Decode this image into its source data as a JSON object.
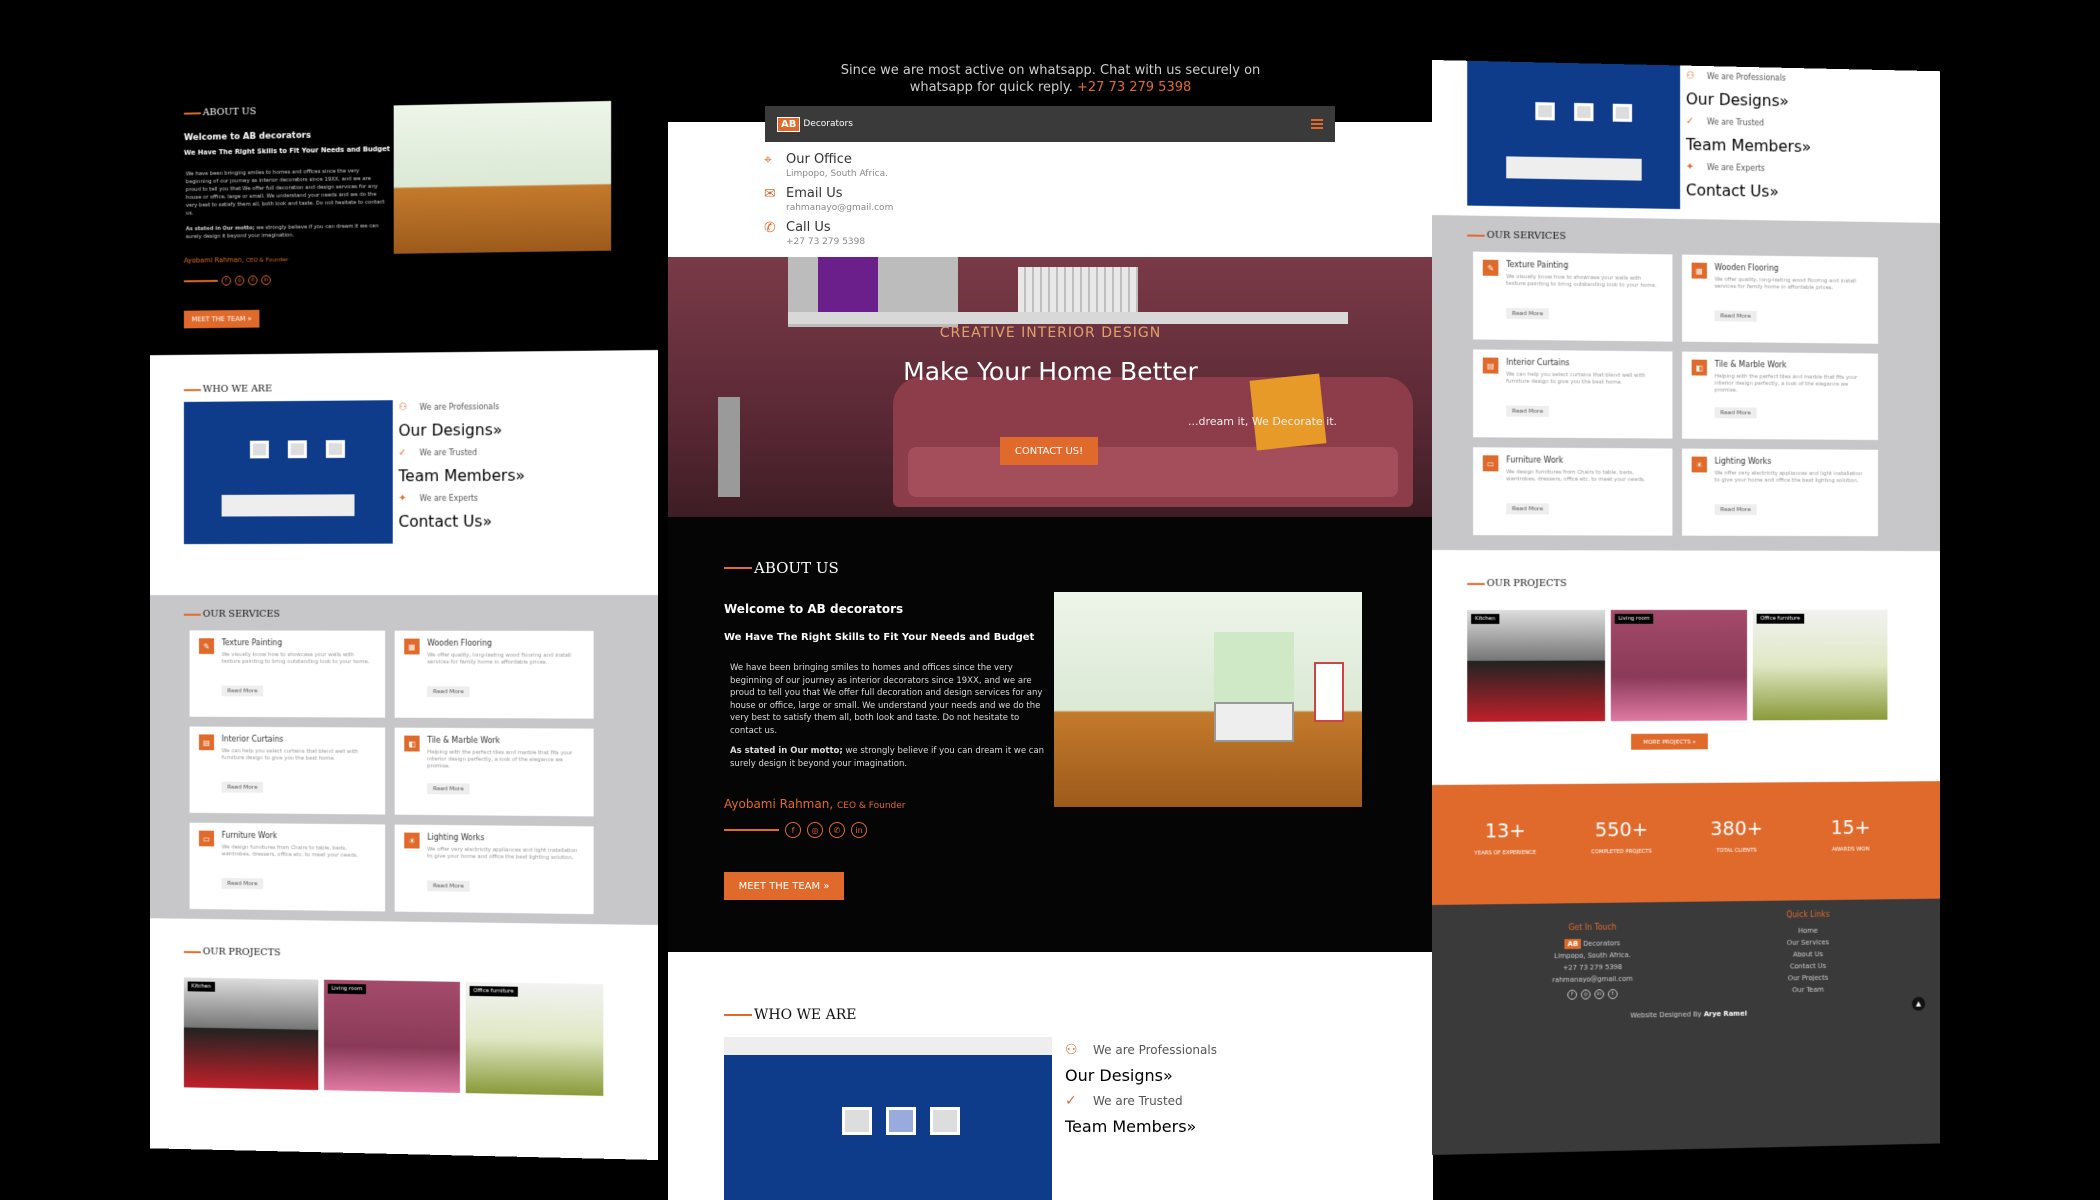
{
  "whatsapp_note": {
    "line1": "Since we are most active on whatsapp. Chat with us securely on",
    "line2": "whatsapp for quick reply.",
    "phone": "+27 73 279 5398"
  },
  "nav": {
    "logo_mark": "AB",
    "logo_text": "Decorators"
  },
  "contacts": [
    {
      "icon": "location-icon",
      "title": "Our Office",
      "value": "Limpopo, South Africa."
    },
    {
      "icon": "email-icon",
      "title": "Email Us",
      "value": "rahmanayo@gmail.com"
    },
    {
      "icon": "phone-icon",
      "title": "Call Us",
      "value": "+27 73 279 5398"
    }
  ],
  "hero": {
    "subtitle": "CREATIVE INTERIOR DESIGN",
    "title": "Make Your Home Better",
    "tagline": "...dream it, We Decorate it.",
    "cta": "CONTACT US!"
  },
  "about": {
    "heading": "ABOUT US",
    "welcome": "Welcome to AB decorators",
    "subhead": "We Have The Right Skills to Fit Your Needs and Budget",
    "paragraph": "We have been bringing smiles to homes and offices since the very beginning of our journey as interior decorators since 19XX, and we are proud to tell you that We offer full decoration and design services for any house or office, large or small. We understand your needs and we do the very best to satisfy them all, both look and taste. Do not hesitate to contact us.",
    "motto_label": "As stated in Our motto;",
    "motto": "we strongly believe if you can dream it we can surely design it beyond your imagination.",
    "author": "Ayobami Rahman,",
    "author_role": "CEO & Founder",
    "team_button": "MEET THE TEAM »"
  },
  "who": {
    "heading": "WHO WE ARE",
    "items": [
      {
        "icon": "professional-icon",
        "title": "We are Professionals",
        "link": "Our Designs»"
      },
      {
        "icon": "check-circle-icon",
        "title": "We are Trusted",
        "link": "Team Members»"
      },
      {
        "icon": "expert-icon",
        "title": "We are Experts",
        "link": "Contact Us»"
      }
    ]
  },
  "services": {
    "heading": "OUR SERVICES",
    "read_more": "Read More",
    "items": [
      {
        "title": "Texture Painting",
        "desc": "We visually know how to showcase your walls with texture painting to bring outstanding look to your home."
      },
      {
        "title": "Wooden Flooring",
        "desc": "We offer quality, long-lasting wood flooring and install services for family home in affordable prices."
      },
      {
        "title": "Interior Curtains",
        "desc": "We can help you select curtains that blend well with furniture design to give you the best home."
      },
      {
        "title": "Tile & Marble Work",
        "desc": "Helping with the perfect tiles and marble that fits your interior design perfectly, a look of the elegance we promise."
      },
      {
        "title": "Furniture Work",
        "desc": "We design furnitures from Chairs to table, beds, wardrobes, dressers, office etc. to meet your needs."
      },
      {
        "title": "Lighting Works",
        "desc": "We offer very electricity appliances and light installation to give your home and office the best lighting solution."
      }
    ]
  },
  "projects": {
    "heading": "OUR PROJECTS",
    "items": [
      {
        "label": "Kitchen"
      },
      {
        "label": "Living room"
      },
      {
        "label": "Office furniture"
      }
    ],
    "more": "MORE PROJECTS »"
  },
  "stats": [
    {
      "value": "13+",
      "label": "YEARS OF EXPERIENCE"
    },
    {
      "value": "550+",
      "label": "COMPLETED PROJECTS"
    },
    {
      "value": "380+",
      "label": "TOTAL CLIENTS"
    },
    {
      "value": "15+",
      "label": "AWARDS WON"
    }
  ],
  "footer": {
    "get_in_touch": "Get In Touch",
    "address": "Limpopo, South Africa.",
    "phone": "+27 73 279 5398",
    "email": "rahmanayo@gmail.com",
    "quick_links_heading": "Quick Links",
    "quick_links": [
      "Home",
      "Our Services",
      "About Us",
      "Contact Us",
      "Our Projects",
      "Our Team"
    ],
    "credit_prefix": "Website Designed By",
    "credit_name": "Arye Ramel"
  },
  "colors": {
    "accent": "#e06a2b",
    "dark": "#050505",
    "services_bg": "#c7c7c9"
  }
}
